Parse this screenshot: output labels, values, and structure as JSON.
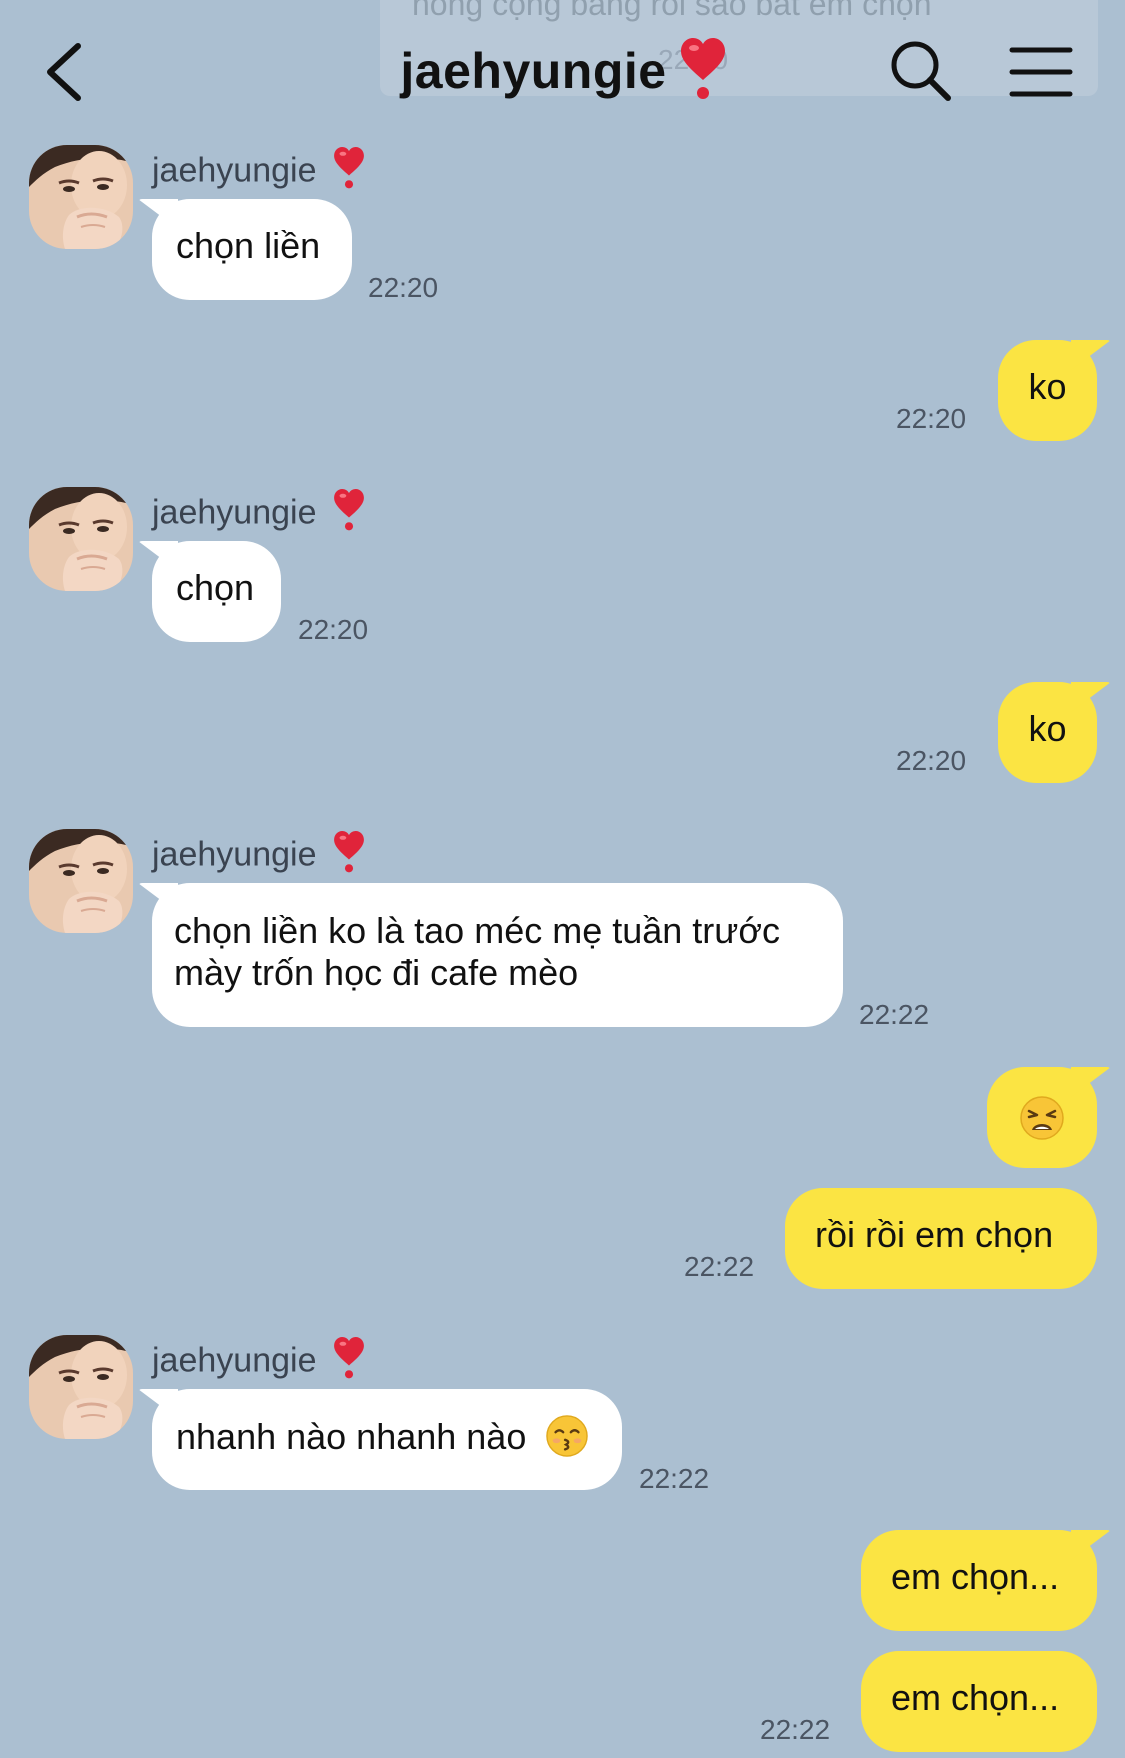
{
  "header": {
    "title": "jaehyungie",
    "title_emoji": "heart-exclamation-icon",
    "ghost_banner_text": "nóng cộng bằng rồi sao bắt em chọn",
    "ghost_banner_time": "22:20"
  },
  "colors": {
    "background": "#abbfd1",
    "incoming_bubble": "#ffffff",
    "outgoing_bubble": "#fbe443",
    "heart": "#e0243a"
  },
  "messages": [
    {
      "direction": "in",
      "sender": "jaehyungie",
      "text": "chọn liền",
      "time": "22:20"
    },
    {
      "direction": "out",
      "text": "ko",
      "time": "22:20"
    },
    {
      "direction": "in",
      "sender": "jaehyungie",
      "text": "chọn",
      "time": "22:20"
    },
    {
      "direction": "out",
      "text": "ko",
      "time": "22:20"
    },
    {
      "direction": "in",
      "sender": "jaehyungie",
      "text_line1": "chọn liền ko là tao méc mẹ tuần trước",
      "text_line2": "mày trốn học đi cafe mèo",
      "time": "22:22"
    },
    {
      "direction": "out",
      "emoji": "weary-face-icon"
    },
    {
      "direction": "out",
      "text": "rồi rồi em chọn",
      "time": "22:22"
    },
    {
      "direction": "in",
      "sender": "jaehyungie",
      "text": "nhanh nào nhanh nào",
      "emoji": "kissing-face-icon",
      "time": "22:22"
    },
    {
      "direction": "out",
      "text": "em chọn..."
    },
    {
      "direction": "out",
      "text": "em chọn...",
      "time": "22:22"
    }
  ]
}
